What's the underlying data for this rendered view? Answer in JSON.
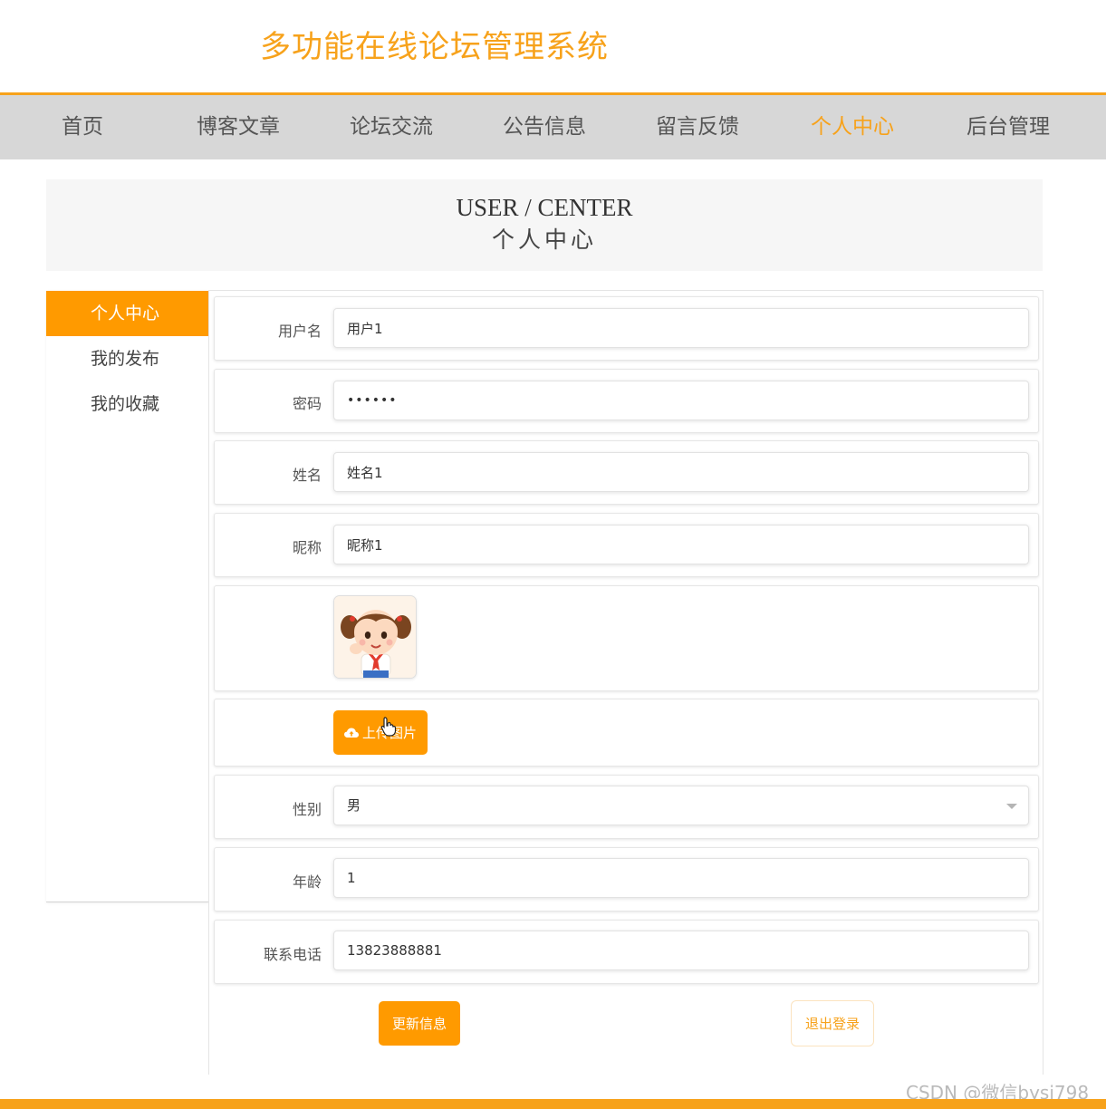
{
  "site": {
    "title": "多功能在线论坛管理系统"
  },
  "nav": {
    "items": [
      "首页",
      "博客文章",
      "论坛交流",
      "公告信息",
      "留言反馈",
      "个人中心",
      "后台管理"
    ],
    "active": "个人中心"
  },
  "banner": {
    "title_en": "USER / CENTER",
    "title_cn": "个人中心"
  },
  "sidebar": {
    "items": [
      "个人中心",
      "我的发布",
      "我的收藏"
    ],
    "active": "个人中心"
  },
  "form": {
    "username": {
      "label": "用户名",
      "value": "用户1"
    },
    "password": {
      "label": "密码",
      "value": "••••••"
    },
    "name": {
      "label": "姓名",
      "value": "姓名1"
    },
    "nickname": {
      "label": "昵称",
      "value": "昵称1"
    },
    "upload_label": "上传图片",
    "gender": {
      "label": "性别",
      "value": "男"
    },
    "age": {
      "label": "年龄",
      "value": "1"
    },
    "phone": {
      "label": "联系电话",
      "value": "13823888881"
    }
  },
  "actions": {
    "update_label": "更新信息",
    "logout_label": "退出登录"
  },
  "theme": {
    "accent": "#f7a21b",
    "button": "#ff9a00",
    "nav_bg": "#d7d7d7"
  },
  "watermark": "CSDN @微信bysj798"
}
